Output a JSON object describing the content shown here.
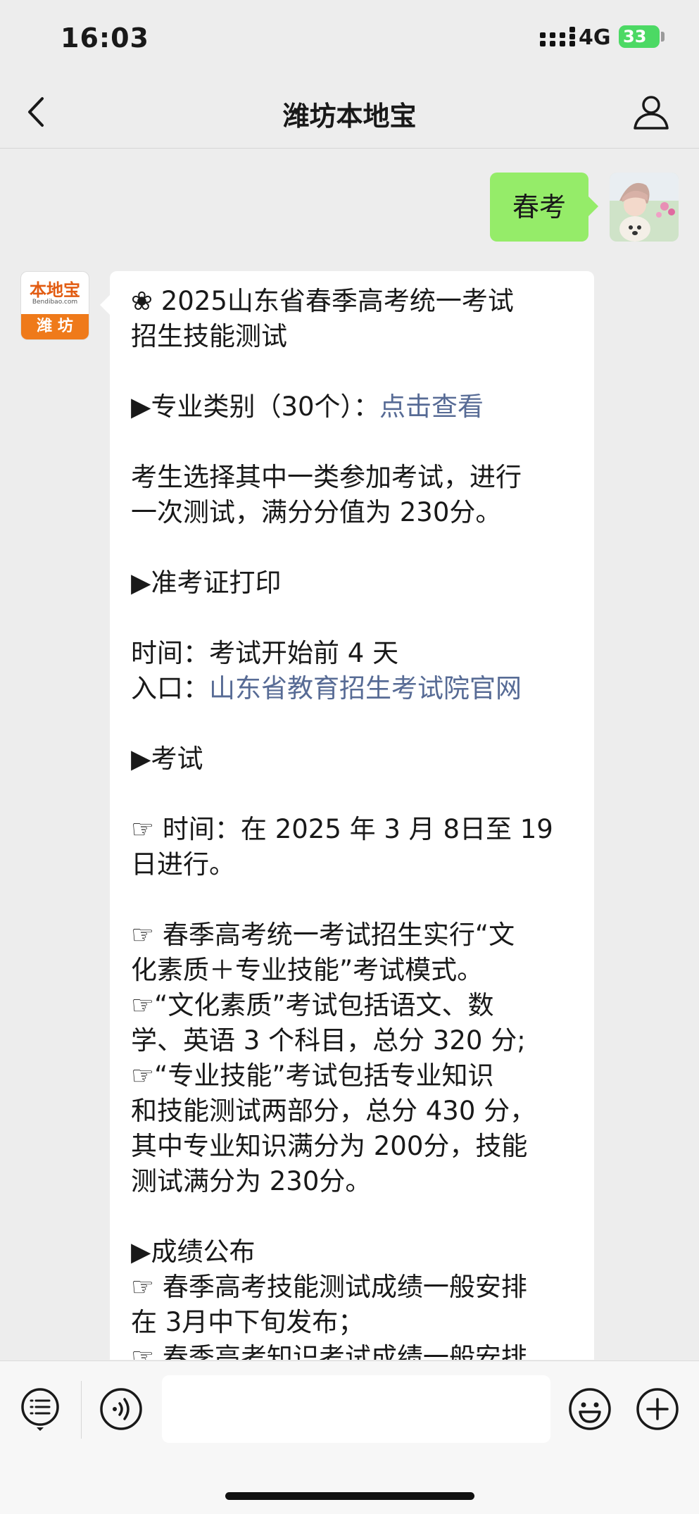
{
  "status_bar": {
    "time": "16:03",
    "network": "4G",
    "battery": "33"
  },
  "nav": {
    "title": "潍坊本地宝"
  },
  "user_message": {
    "text": "春考"
  },
  "bot_avatar": {
    "top": "本地宝",
    "domain": "Bendibao.com",
    "bottom": "潍 坊"
  },
  "bot_message": {
    "lines": [
      {
        "text": "❀ 2025山东省春季高考统一考试"
      },
      {
        "text": "招生技能测试"
      },
      {
        "text": ""
      },
      {
        "text": "▶专业类别（30个）：",
        "link": "点击查看"
      },
      {
        "text": ""
      },
      {
        "text": "考生选择其中一类参加考试，进行"
      },
      {
        "text": "一次测试，满分分值为 230分。"
      },
      {
        "text": ""
      },
      {
        "text": "▶准考证打印"
      },
      {
        "text": ""
      },
      {
        "text": "时间：考试开始前 4 天"
      },
      {
        "text": "入口：",
        "link": "山东省教育招生考试院官网"
      },
      {
        "text": ""
      },
      {
        "text": "▶考试"
      },
      {
        "text": ""
      },
      {
        "text": "☞ 时间：在 2025 年 3 月 8日至 19"
      },
      {
        "text": "日进行。"
      },
      {
        "text": ""
      },
      {
        "text": "☞ 春季高考统一考试招生实行“文"
      },
      {
        "text": "化素质＋专业技能”考试模式。"
      },
      {
        "text": "☞“文化素质”考试包括语文、数"
      },
      {
        "text": "学、英语 3 个科目，总分 320 分;"
      },
      {
        "text": "☞“专业技能”考试包括专业知识"
      },
      {
        "text": "和技能测试两部分，总分 430 分，"
      },
      {
        "text": "其中专业知识满分为 200分，技能"
      },
      {
        "text": "测试满分为 230分。"
      },
      {
        "text": ""
      },
      {
        "text": "▶成绩公布"
      },
      {
        "text": "☞ 春季高考技能测试成绩一般安排"
      },
      {
        "text": "在 3月中下旬发布；"
      },
      {
        "text": "☞ 春季高考知识考试成绩一般安排"
      }
    ]
  },
  "input_bar": {
    "placeholder": ""
  },
  "colors": {
    "user_bubble": "#95ec69",
    "link": "#576b95",
    "battery": "#4cd964",
    "background": "#ededed"
  }
}
